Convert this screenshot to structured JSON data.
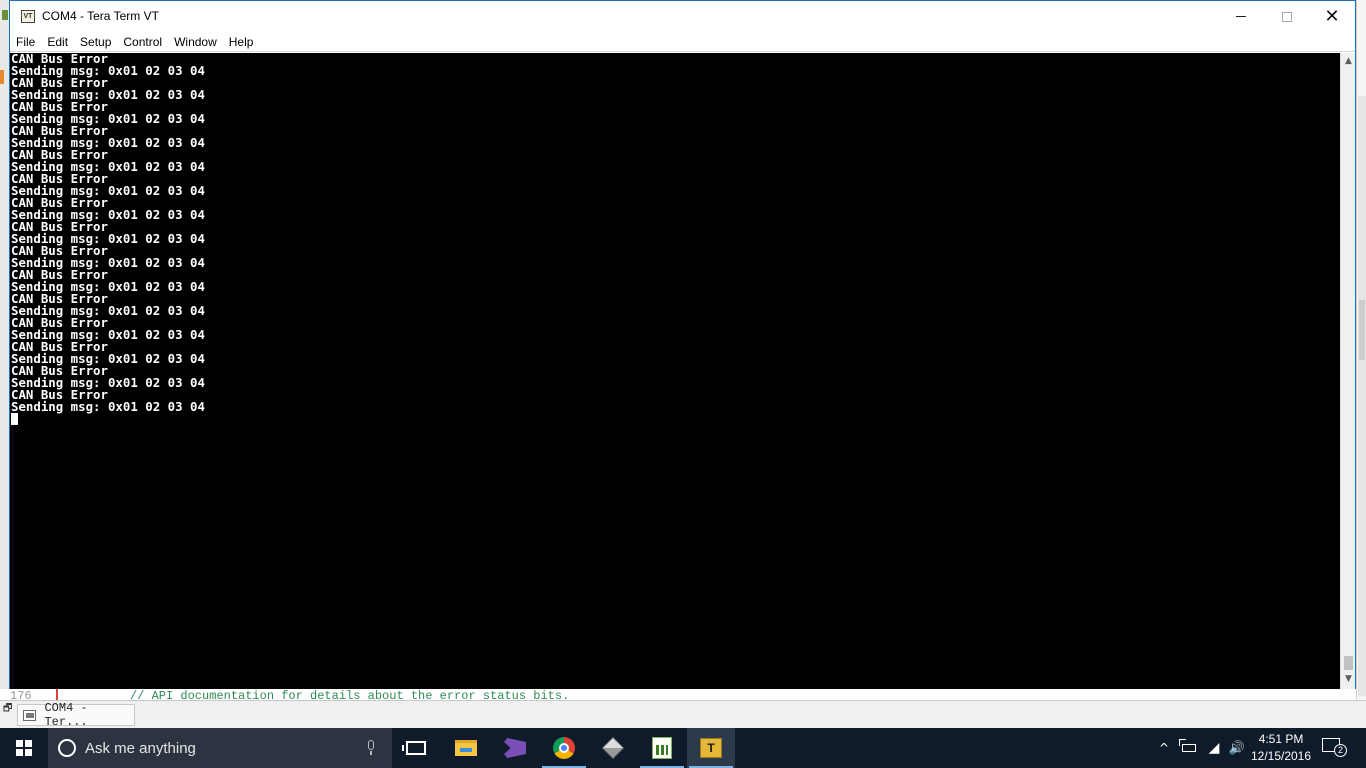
{
  "window": {
    "title": "COM4 - Tera Term VT",
    "icon_label": "VT",
    "menu": [
      "File",
      "Edit",
      "Setup",
      "Control",
      "Window",
      "Help"
    ]
  },
  "terminal": {
    "lines": [
      "CAN Bus Error",
      "Sending msg: 0x01 02 03 04",
      "CAN Bus Error",
      "Sending msg: 0x01 02 03 04",
      "CAN Bus Error",
      "Sending msg: 0x01 02 03 04",
      "CAN Bus Error",
      "Sending msg: 0x01 02 03 04",
      "CAN Bus Error",
      "Sending msg: 0x01 02 03 04",
      "CAN Bus Error",
      "Sending msg: 0x01 02 03 04",
      "CAN Bus Error",
      "Sending msg: 0x01 02 03 04",
      "CAN Bus Error",
      "Sending msg: 0x01 02 03 04",
      "CAN Bus Error",
      "Sending msg: 0x01 02 03 04",
      "CAN Bus Error",
      "Sending msg: 0x01 02 03 04",
      "CAN Bus Error",
      "Sending msg: 0x01 02 03 04",
      "CAN Bus Error",
      "Sending msg: 0x01 02 03 04",
      "CAN Bus Error",
      "Sending msg: 0x01 02 03 04",
      "CAN Bus Error",
      "Sending msg: 0x01 02 03 04",
      "CAN Bus Error",
      "Sending msg: 0x01 02 03 04"
    ]
  },
  "background_editor": {
    "line_number": "176",
    "code": "// API documentation for details about the error status bits."
  },
  "minimized_window": {
    "label": "COM4 - Ter..."
  },
  "taskbar": {
    "search_placeholder": "Ask me anything",
    "apps": [
      "task-view",
      "file-explorer",
      "visual-studio",
      "chrome",
      "3d-app",
      "chart-app",
      "tera-term"
    ],
    "active_app": "tera-term",
    "time": "4:51 PM",
    "date": "12/15/2016",
    "notification_count": "2"
  },
  "colors": {
    "terminal_bg": "#000000",
    "terminal_fg": "#ffffff",
    "taskbar_bg": "#0f1b2a",
    "window_border": "#1f6fb5"
  }
}
